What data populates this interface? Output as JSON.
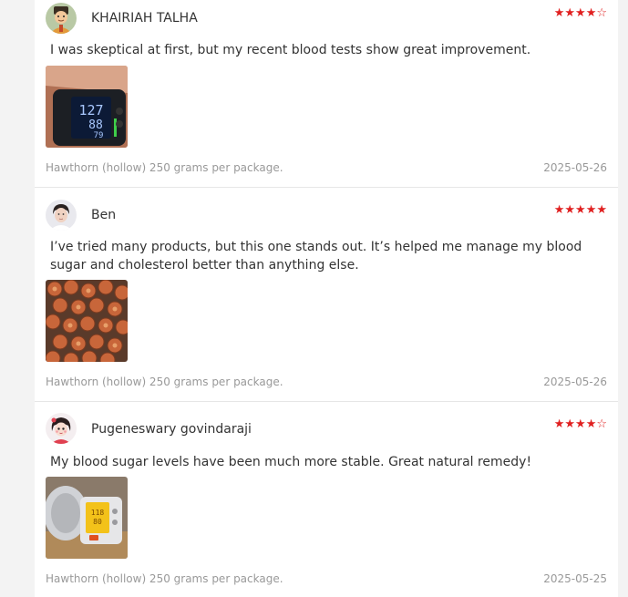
{
  "reviews": [
    {
      "reviewer": "KHAIRIAH TALHA",
      "avatar_icon": "cartoon-avatar-icon",
      "rating": 4,
      "rating_max": 5,
      "text": "I was skeptical at first, but my recent blood tests show great improvement.",
      "photo": "blood-pressure-monitor-photo",
      "variant": "Hawthorn (hollow) 250 grams per package.",
      "date": "2025-05-26"
    },
    {
      "reviewer": "Ben",
      "avatar_icon": "profile-photo-icon",
      "rating": 5,
      "rating_max": 5,
      "text": "I’ve tried many products, but this one stands out. It’s helped me manage my blood sugar and cholesterol better than anything else.",
      "photo": "dried-hawthorn-photo",
      "variant": "Hawthorn (hollow) 250 grams per package.",
      "date": "2025-05-26"
    },
    {
      "reviewer": "Pugeneswary govindaraji",
      "avatar_icon": "cartoon-girl-avatar-icon",
      "rating": 4,
      "rating_max": 5,
      "text": "My blood sugar levels have been much more stable. Great natural remedy!",
      "photo": "blood-pressure-monitor-photo",
      "variant": "Hawthorn (hollow) 250 grams per package.",
      "date": "2025-05-25"
    }
  ],
  "colors": {
    "star": "#e02020",
    "text": "#333333",
    "meta": "#999999",
    "page_background": "#f3f3f3",
    "panel_background": "#ffffff"
  }
}
